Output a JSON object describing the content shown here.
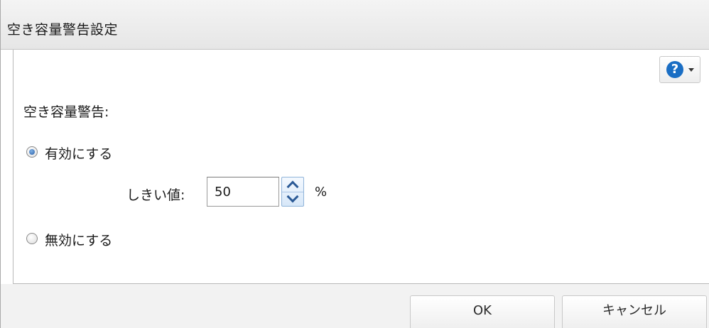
{
  "dialog": {
    "title": "空き容量警告設定"
  },
  "help": {
    "glyph": "?"
  },
  "settings": {
    "section_label": "空き容量警告:",
    "options": [
      {
        "label": "有効にする",
        "checked": true
      },
      {
        "label": "無効にする",
        "checked": false
      }
    ],
    "threshold": {
      "label": "しきい値:",
      "value": "50",
      "unit": "%"
    }
  },
  "footer": {
    "ok_label": "OK",
    "cancel_label": "キャンセル"
  },
  "colors": {
    "help_icon": "#1a6ec4",
    "radio_selected": "#2a5ea6",
    "spin_border": "#8fb3d9"
  }
}
